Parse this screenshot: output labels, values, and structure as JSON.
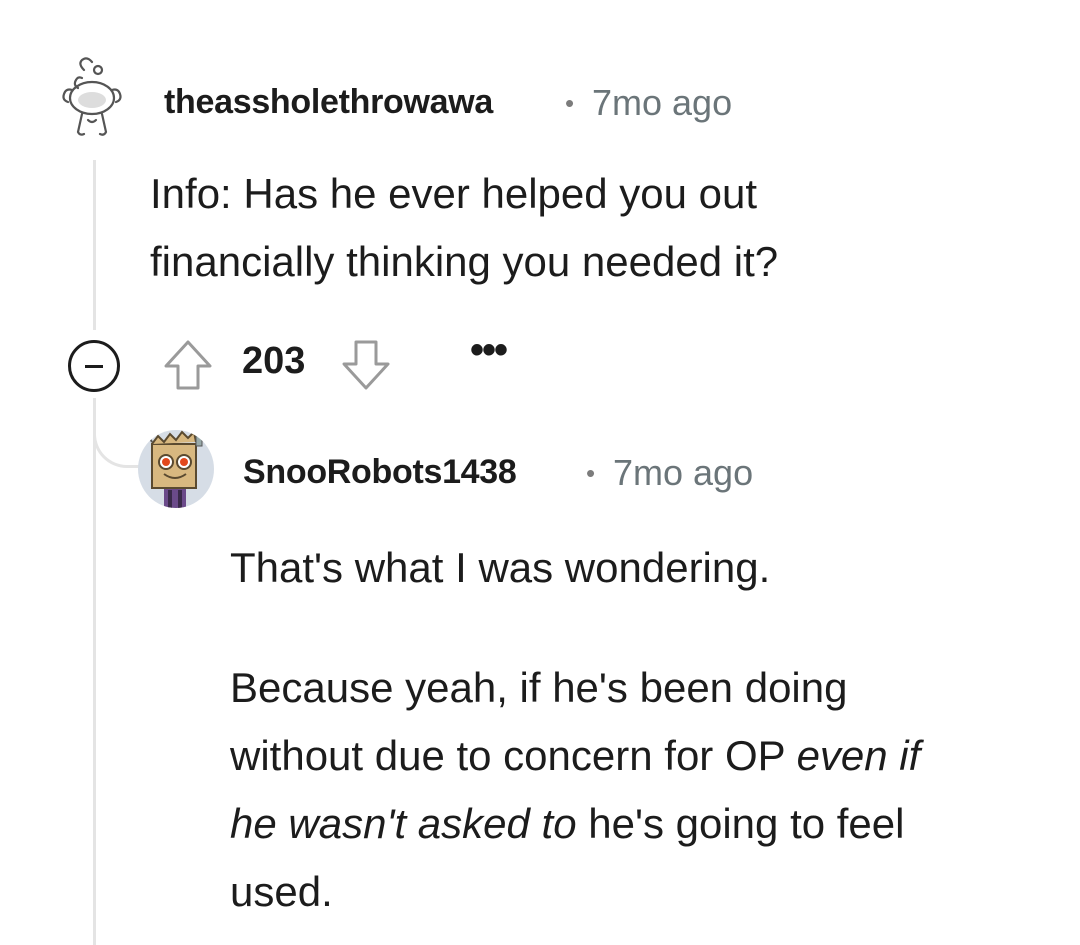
{
  "comment1": {
    "username": "theassholethrowawa",
    "separator": "•",
    "time": "7mo ago",
    "body_line1": "Info: Has he ever helped you out",
    "body_line2": "financially thinking you needed it?",
    "votes": "203",
    "more_label": "•••",
    "avatar_icon": "snoo-default-icon",
    "upvote_icon": "upvote-arrow-icon",
    "downvote_icon": "downvote-arrow-icon",
    "collapse_icon": "collapse-minus-icon"
  },
  "comment2": {
    "username": "SnooRobots1438",
    "separator": "•",
    "time": "7mo ago",
    "paragraph1": "That's what I was wondering.",
    "paragraph2": {
      "line1": "Because yeah, if he's been doing",
      "line2_normal": "without due to concern for OP ",
      "line2_italic": "even if",
      "line3_italic": "he wasn't asked to",
      "line3_normal": " he's going to feel",
      "line4": "used."
    },
    "avatar_icon": "snoo-robot-avatar-icon"
  },
  "colors": {
    "text": "#1c1c1c",
    "meta": "#6b7579",
    "thread_line": "#e4e4e4"
  }
}
